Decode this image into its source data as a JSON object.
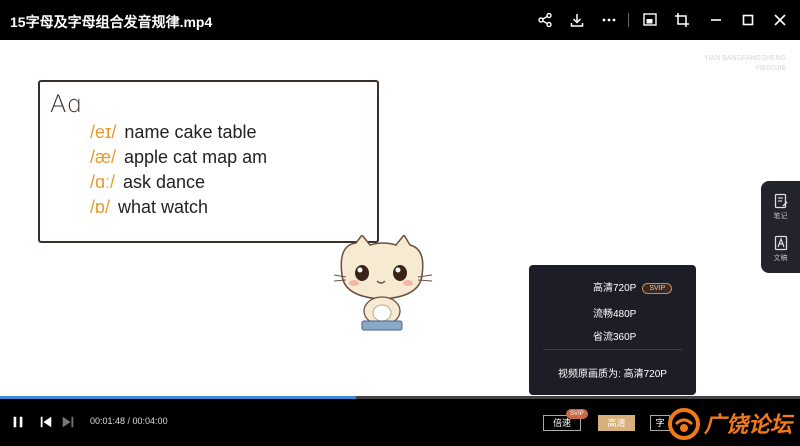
{
  "window": {
    "title": "15字母及字母组合发音规律.mp4",
    "icons": [
      "share-icon",
      "download-icon",
      "more-icon",
      "picture-in-picture-icon",
      "crop-icon",
      "minimize-icon",
      "maximize-icon",
      "close-icon"
    ]
  },
  "video": {
    "watermark_line1": "YIAN BANGFANGSHENG",
    "watermark_line2": "YIBAOJIE",
    "board": {
      "title": "Aɑ",
      "rows": [
        {
          "phonetic": "/eɪ/",
          "words": "name cake table"
        },
        {
          "phonetic": "/æ/",
          "words": "apple cat map am"
        },
        {
          "phonetic": "/ɑː/",
          "words": "ask dance"
        },
        {
          "phonetic": "/ɒ/",
          "words": "what watch"
        }
      ]
    }
  },
  "quality_menu": {
    "items": [
      {
        "label": "高清720P",
        "badge": "SVIP"
      },
      {
        "label": "流畅480P",
        "badge": ""
      },
      {
        "label": "省流360P",
        "badge": ""
      }
    ],
    "source_text": "视频原画质为: 高清720P"
  },
  "side_panel": {
    "notes_label": "笔记",
    "doc_label": "文稿"
  },
  "playback": {
    "progress": 0.445,
    "current_time": "00:01:48",
    "total_time": "00:04:00",
    "time_text": "00:01:48 / 00:04:00",
    "speed_label": "倍速",
    "speed_badge": "SVIP",
    "quality_label": "高清",
    "subtitle_label": "字"
  },
  "overlay_logo_text": "广饶论坛",
  "colors": {
    "accent_blue": "#3d8ad9",
    "phonetic_orange": "#e69a2e",
    "quality_gold": "#d8b07c",
    "logo_orange": "#f07a1a"
  }
}
